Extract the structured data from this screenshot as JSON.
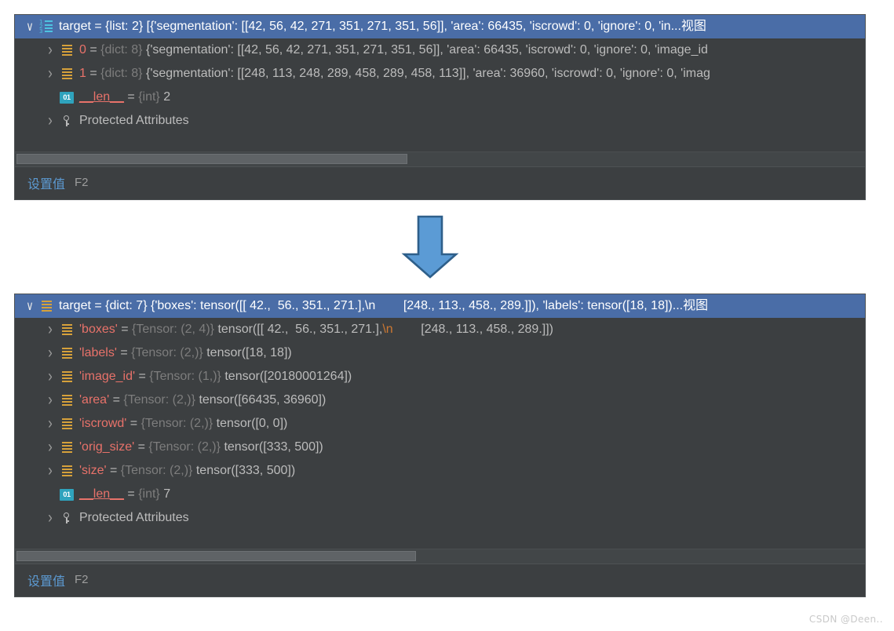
{
  "panels": [
    {
      "id": "list-target-panel",
      "rows": [
        {
          "indent": 0,
          "chevron": "down",
          "icon": "list-icon",
          "selected": true,
          "name": "target",
          "eq": " = ",
          "type": "{list: 2}",
          "value": "[{'segmentation': [[42, 56, 42, 271, 351, 271, 351, 56]], 'area': 66435, 'iscrowd': 0, 'ignore': 0, 'in...视图"
        },
        {
          "indent": 1,
          "chevron": "right",
          "icon": "dict-icon",
          "selected": false,
          "name": "0",
          "eq": " = ",
          "type": "{dict: 8}",
          "value": "{'segmentation': [[42, 56, 42, 271, 351, 271, 351, 56]], 'area': 66435, 'iscrowd': 0, 'ignore': 0, 'image_id"
        },
        {
          "indent": 1,
          "chevron": "right",
          "icon": "dict-icon",
          "selected": false,
          "name": "1",
          "eq": " = ",
          "type": "{dict: 8}",
          "value": "{'segmentation': [[248, 113, 248, 289, 458, 289, 458, 113]], 'area': 36960, 'iscrowd': 0, 'ignore': 0, 'imag"
        },
        {
          "indent": 1,
          "chevron": "blank",
          "icon": "int-icon",
          "selected": false,
          "name": "__len__",
          "eq": " = ",
          "type": "{int}",
          "value": "2"
        },
        {
          "indent": 1,
          "chevron": "right",
          "icon": "protected-icon",
          "selected": false,
          "name": "Protected Attributes",
          "eq": "",
          "type": "",
          "value": ""
        }
      ],
      "scrollbar": {
        "thumb_percent": 46
      },
      "footer": {
        "link": "设置值",
        "shortcut": "F2"
      }
    },
    {
      "id": "dict-target-panel",
      "rows": [
        {
          "indent": 0,
          "chevron": "down",
          "icon": "dict-icon",
          "selected": true,
          "name": "target",
          "eq": " = ",
          "type": "{dict: 7}",
          "value": "{'boxes': tensor([[ 42.,  56., 351., 271.],\\n        [248., 113., 458., 289.]]), 'labels': tensor([18, 18])...视图"
        },
        {
          "indent": 1,
          "chevron": "right",
          "icon": "dict-icon",
          "selected": false,
          "name": "'boxes'",
          "eq": " = ",
          "type": "{Tensor: (2, 4)}",
          "value_pre": "tensor([[ 42.,  56., 351., 271.],",
          "value_escape": "\\n",
          "value_post": "        [248., 113., 458., 289.]])"
        },
        {
          "indent": 1,
          "chevron": "right",
          "icon": "dict-icon",
          "selected": false,
          "name": "'labels'",
          "eq": " = ",
          "type": "{Tensor: (2,)}",
          "value": "tensor([18, 18])"
        },
        {
          "indent": 1,
          "chevron": "right",
          "icon": "dict-icon",
          "selected": false,
          "name": "'image_id'",
          "eq": " = ",
          "type": "{Tensor: (1,)}",
          "value": "tensor([20180001264])"
        },
        {
          "indent": 1,
          "chevron": "right",
          "icon": "dict-icon",
          "selected": false,
          "name": "'area'",
          "eq": " = ",
          "type": "{Tensor: (2,)}",
          "value": "tensor([66435, 36960])"
        },
        {
          "indent": 1,
          "chevron": "right",
          "icon": "dict-icon",
          "selected": false,
          "name": "'iscrowd'",
          "eq": " = ",
          "type": "{Tensor: (2,)}",
          "value": "tensor([0, 0])"
        },
        {
          "indent": 1,
          "chevron": "right",
          "icon": "dict-icon",
          "selected": false,
          "name": "'orig_size'",
          "eq": " = ",
          "type": "{Tensor: (2,)}",
          "value": "tensor([333, 500])"
        },
        {
          "indent": 1,
          "chevron": "right",
          "icon": "dict-icon",
          "selected": false,
          "name": "'size'",
          "eq": " = ",
          "type": "{Tensor: (2,)}",
          "value": "tensor([333, 500])"
        },
        {
          "indent": 1,
          "chevron": "blank",
          "icon": "int-icon",
          "selected": false,
          "name": "__len__",
          "eq": " = ",
          "type": "{int}",
          "value": "7"
        },
        {
          "indent": 1,
          "chevron": "right",
          "icon": "protected-icon",
          "selected": false,
          "name": "Protected Attributes",
          "eq": "",
          "type": "",
          "value": ""
        }
      ],
      "scrollbar": {
        "thumb_percent": 47
      },
      "footer": {
        "link": "设置值",
        "shortcut": "F2"
      }
    }
  ],
  "arrow": {
    "name": "down-arrow",
    "fill": "#5b9bd5",
    "stroke": "#2e5f8a"
  },
  "int_icon_label": "01",
  "list_icon_digits": "1\n2\n3",
  "watermark": "CSDN @Deen..",
  "colors": {
    "panel_bg": "#3c3f41",
    "selection": "#4a6da7",
    "key_text": "#e8726a",
    "dim_text": "#7d7d7d",
    "value_text": "#bcbcbc",
    "escape_text": "#cc7832",
    "link": "#5c9ad2",
    "dict_icon": "#d6a13b",
    "list_icon": "#4ec3e0",
    "int_icon": "#2fa3bd"
  }
}
